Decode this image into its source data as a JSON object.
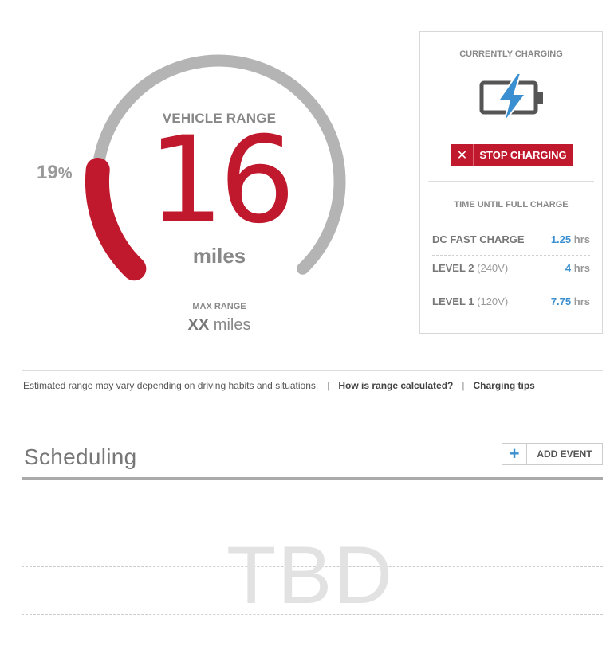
{
  "gauge": {
    "title": "VEHICLE RANGE",
    "value": "16",
    "unit": "miles",
    "percent_value": "19",
    "percent_sign": "%",
    "fill_fraction": 0.19,
    "track_color": "#b4b4b4",
    "fill_color": "#c0182c"
  },
  "max_range": {
    "label": "MAX RANGE",
    "value": "XX",
    "unit": "miles"
  },
  "charging": {
    "title": "CURRENTLY CHARGING",
    "icon": "battery-charging-icon",
    "stop_label": "STOP CHARGING",
    "time_title": "TIME UNTIL FULL CHARGE",
    "rates": [
      {
        "name": "DC FAST CHARGE",
        "voltage": "",
        "time": "1.25",
        "unit": "hrs"
      },
      {
        "name": "LEVEL 2",
        "voltage": "(240V)",
        "time": "4",
        "unit": "hrs"
      },
      {
        "name": "LEVEL 1",
        "voltage": "(120V)",
        "time": "7.75",
        "unit": "hrs"
      }
    ]
  },
  "note": {
    "text": "Estimated range may vary depending on driving habits and situations.",
    "separator": "|",
    "link1": "How is range calculated?",
    "link2": "Charging tips"
  },
  "scheduling": {
    "title": "Scheduling",
    "add_label": "ADD EVENT",
    "placeholder": "TBD"
  },
  "colors": {
    "accent_red": "#c0182c",
    "accent_blue": "#3a8fd0"
  }
}
